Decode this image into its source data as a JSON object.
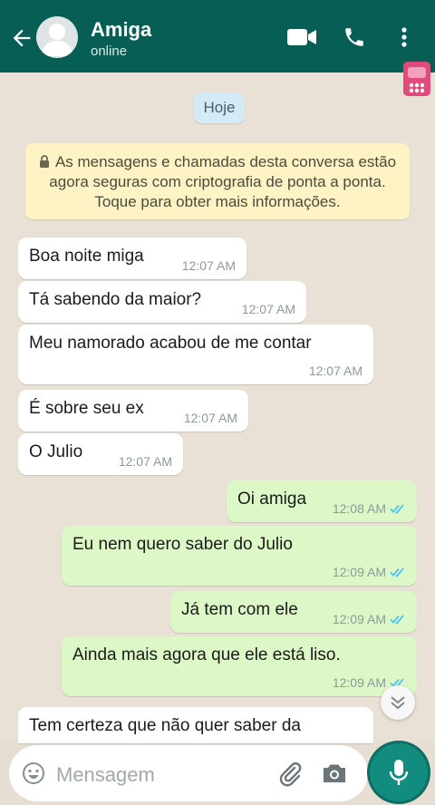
{
  "header": {
    "contact_name": "Amiga",
    "contact_status": "online",
    "back_icon": "arrow-left-icon",
    "video_icon": "video-camera-icon",
    "call_icon": "phone-icon",
    "menu_icon": "more-vertical-icon",
    "bg_color": "#075e54"
  },
  "chat": {
    "date_label": "Hoje",
    "encryption_notice": "As mensagens e chamadas desta conversa estão agora seguras com criptografia de ponta a ponta. Toque para obter mais informações.",
    "messages": [
      {
        "direction": "in",
        "text": "Boa noite miga",
        "time": "12:07 AM"
      },
      {
        "direction": "in",
        "text": "Tá sabendo da maior?",
        "time": "12:07 AM"
      },
      {
        "direction": "in",
        "text": "Meu namorado acabou de me contar",
        "time": "12:07 AM"
      },
      {
        "direction": "in",
        "text": "É sobre seu ex",
        "time": "12:07 AM"
      },
      {
        "direction": "in",
        "text": "O Julio",
        "time": "12:07 AM"
      },
      {
        "direction": "out",
        "text": "Oi amiga",
        "time": "12:08 AM",
        "status": "read"
      },
      {
        "direction": "out",
        "text": "Eu nem quero saber do Julio",
        "time": "12:09 AM",
        "status": "read"
      },
      {
        "direction": "out",
        "text": "Já tem com ele",
        "time": "12:09 AM",
        "status": "read"
      },
      {
        "direction": "out",
        "text": "Ainda mais agora que ele está liso.",
        "time": "12:09 AM",
        "status": "read"
      },
      {
        "direction": "in",
        "text": "Tem certeza que não quer saber da",
        "time": ""
      }
    ],
    "incoming_color": "#ffffff",
    "outgoing_color": "#dcf8c6",
    "read_tick_color": "#4fc3f7"
  },
  "composer": {
    "placeholder": "Mensagem",
    "emoji_icon": "emoji-icon",
    "attach_icon": "paperclip-icon",
    "camera_icon": "camera-icon",
    "mic_icon": "microphone-icon",
    "scroll_icon": "double-chevron-down-icon"
  }
}
